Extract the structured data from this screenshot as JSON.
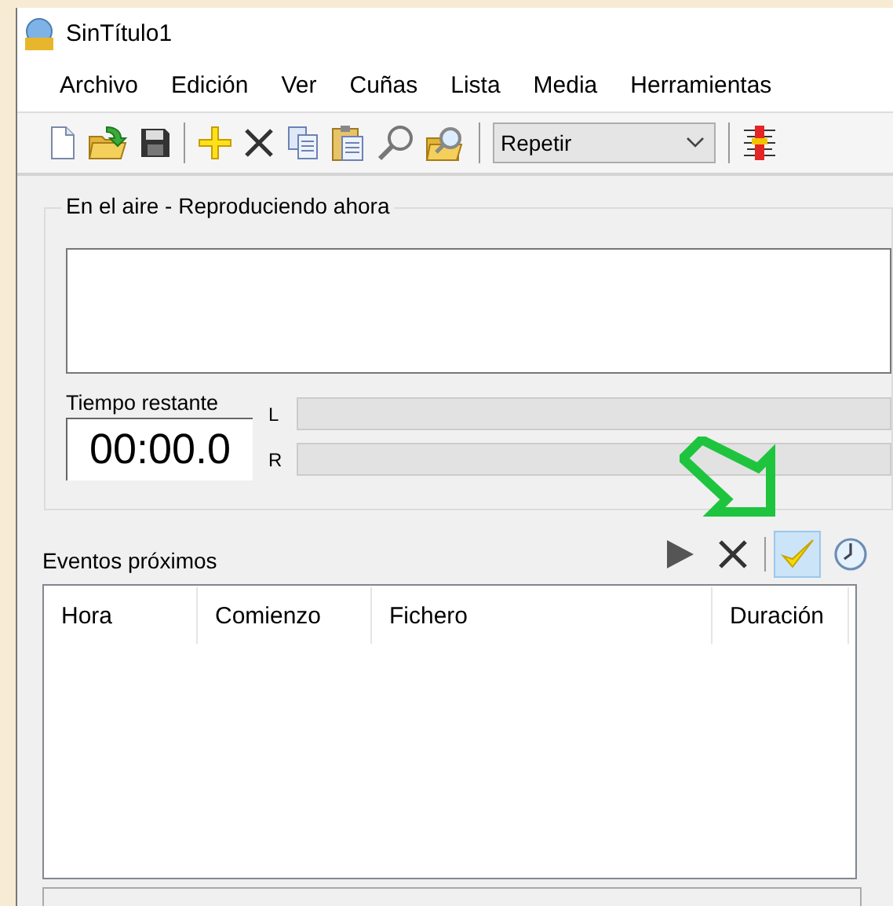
{
  "window": {
    "title": "SinTítulo1"
  },
  "menu": [
    "Archivo",
    "Edición",
    "Ver",
    "Cuñas",
    "Lista",
    "Media",
    "Herramientas"
  ],
  "toolbar": {
    "mode_select": {
      "value": "Repetir"
    }
  },
  "on_air": {
    "title": "En el aire - Reproduciendo ahora",
    "remaining_label": "Tiempo restante",
    "remaining_time": "00:00.0",
    "meters": [
      {
        "label": "L",
        "level": 0
      },
      {
        "label": "R",
        "level": 0
      }
    ]
  },
  "upcoming": {
    "title": "Eventos próximos",
    "tools": [
      {
        "kind": "play",
        "selected": false
      },
      {
        "kind": "delete",
        "selected": false
      },
      {
        "kind": "confirm",
        "selected": true
      },
      {
        "kind": "clock",
        "selected": false
      }
    ],
    "columns": [
      "Hora",
      "Comienzo",
      "Fichero",
      "Duración"
    ]
  }
}
